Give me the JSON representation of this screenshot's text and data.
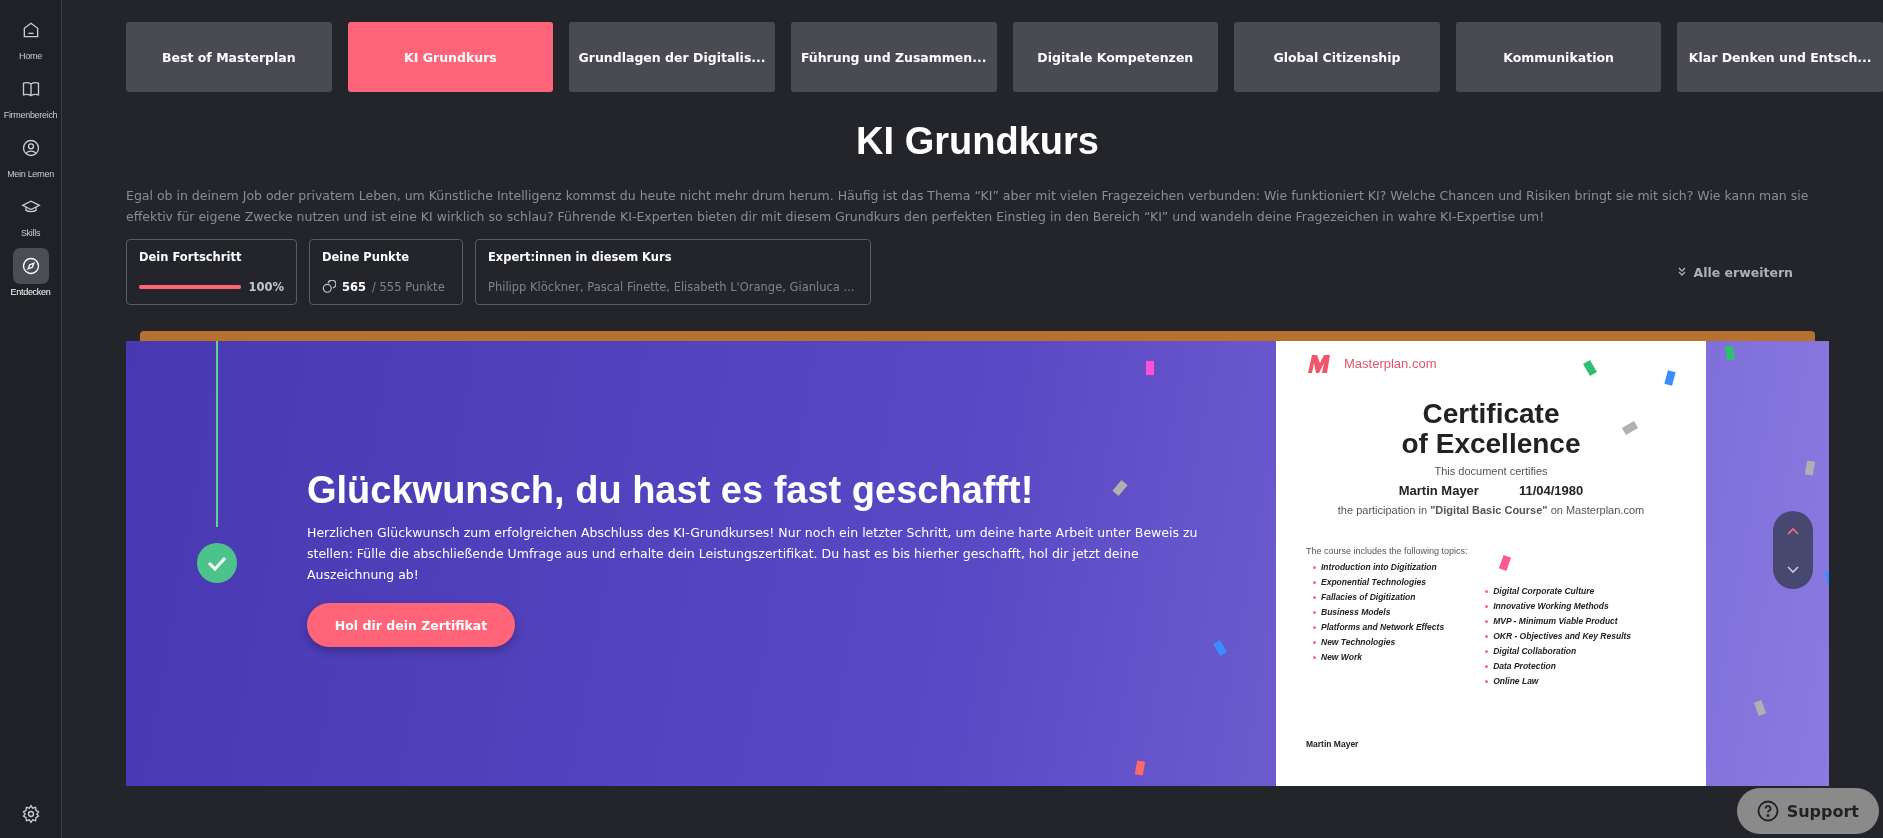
{
  "sidebar": {
    "items": [
      {
        "kind": "home",
        "label": "Home",
        "selected": false
      },
      {
        "kind": "book",
        "label": "Firmenbereich",
        "selected": false
      },
      {
        "kind": "user",
        "label": "Mein Lernen",
        "selected": false
      },
      {
        "kind": "cap",
        "label": "Skills",
        "selected": false
      },
      {
        "kind": "compass",
        "label": "Entdecken",
        "selected": true
      }
    ]
  },
  "tabs": [
    {
      "label": "Best of Masterplan",
      "selected": false
    },
    {
      "label": "KI Grundkurs",
      "selected": true
    },
    {
      "label": "Grundlagen der Digitalis...",
      "selected": false
    },
    {
      "label": "Führung und Zusammen...",
      "selected": false
    },
    {
      "label": "Digitale Kompetenzen",
      "selected": false
    },
    {
      "label": "Global Citizenship",
      "selected": false
    },
    {
      "label": "Kommunikation",
      "selected": false
    },
    {
      "label": "Klar Denken und Entsch...",
      "selected": false
    }
  ],
  "course": {
    "title": "KI Grundkurs",
    "description": "Egal ob in deinem Job oder privatem Leben, um Künstliche Intelligenz kommst du heute nicht mehr drum herum. Häufig ist das Thema “KI” aber mit vielen Fragezeichen verbunden: Wie funktioniert KI? Welche Chancen und Risiken bringt sie mit sich? Wie kann man sie effektiv für eigene Zwecke nutzen und ist eine KI wirklich so schlau? Führende KI-Experten bieten dir mit diesem Grundkurs den perfekten Einstieg in den Bereich “KI” und wandeln deine Fragezeichen in wahre KI-Expertise um!",
    "progress": {
      "label": "Dein Fortschritt",
      "level": 1,
      "reading": "100%"
    },
    "points": {
      "label": "Deine Punkte",
      "earned": "565",
      "total": "/ 555 Punkte"
    },
    "experts": {
      "label": "Expert:innen in diesem Kurs",
      "names": "Philipp Klöckner, Pascal Finette, Elisabeth L'Orange, Gianluca ..."
    },
    "expand_all": "Alle erweitern"
  },
  "banner": {
    "completed": true,
    "heading": "Glückwunsch, du hast es fast geschafft!",
    "text": "Herzlichen Glückwunsch zum erfolgreichen Abschluss des KI-Grundkurses! Nur noch ein letzter Schritt, um deine harte Arbeit unter Beweis zu stellen: Fülle die abschließende Umfrage aus und erhalte dein Leistungszertifikat. Du hast es bis hierher geschafft, hol dir jetzt deine Auszeichnung ab!",
    "button": "Hol dir dein Zertifikat",
    "certificate": {
      "brand": "Masterplan.com",
      "title_1": "Certificate",
      "title_2": "of Excellence",
      "certifies": "This document certifies",
      "name": "Martin Mayer",
      "date": "11/04/1980",
      "participation": "the participation in **\"Digital Basic Course\"** on Masterplan.com",
      "topics_intro": "The course includes the following topics:",
      "topics_left": [
        "Introduction into Digitization",
        "Exponential Technologies",
        "Fallacies of Digitization",
        "Business Models",
        "Platforms and Network Effects",
        "New Technologies",
        "New Work"
      ],
      "topics_right": [
        "Digital Corporate Culture",
        "Innovative Working Methods",
        "MVP - Minimum Viable Product",
        "OKR - Objectives and Key Results",
        "Digital Collaboration",
        "Data Protection",
        "Online Law"
      ],
      "signature_name": "Martin Mayer"
    }
  },
  "support": {
    "label": "Support"
  }
}
